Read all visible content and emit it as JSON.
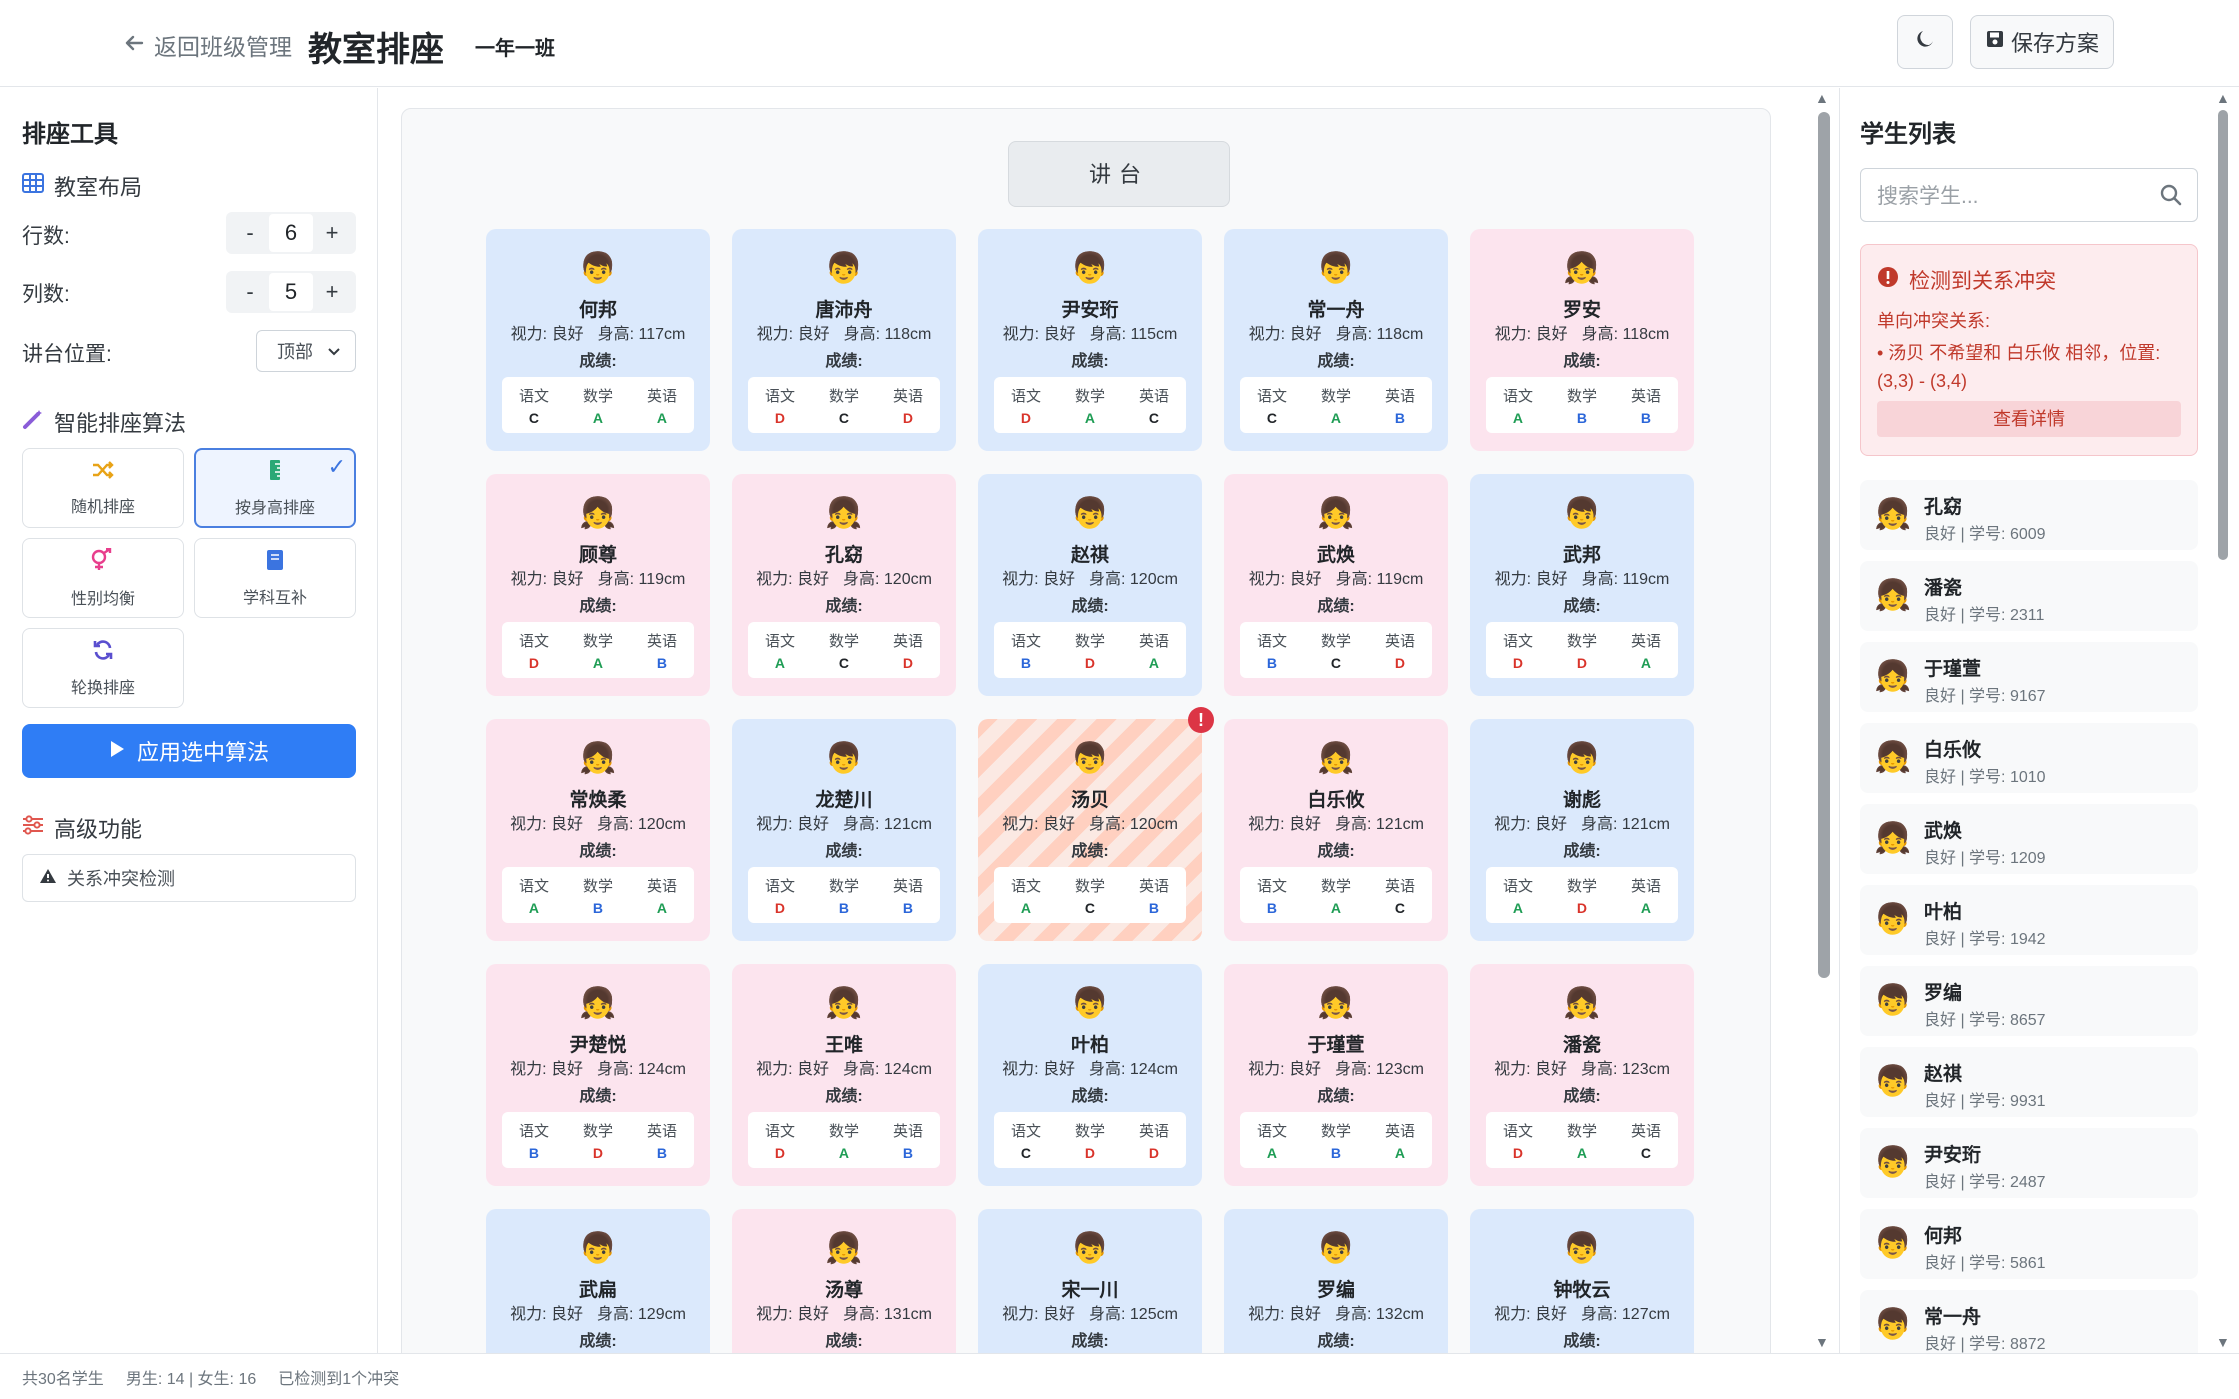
{
  "header": {
    "back_label": "返回班级管理",
    "title": "教室排座",
    "class_name": "一年一班",
    "save_label": "保存方案"
  },
  "tools": {
    "title": "排座工具",
    "layout_heading": "教室布局",
    "rows_label": "行数:",
    "rows_value": "6",
    "cols_label": "列数:",
    "cols_value": "5",
    "podium_label": "讲台位置:",
    "podium_value": "顶部",
    "minus": "-",
    "plus": "+",
    "algo_heading": "智能排座算法",
    "algorithms": [
      "随机排座",
      "按身高排座",
      "性别均衡",
      "学科互补",
      "轮换排座"
    ],
    "selected_algorithm": "按身高排座",
    "apply_label": "应用选中算法",
    "advanced_heading": "高级功能",
    "conflict_check_label": "关系冲突检测"
  },
  "classroom": {
    "podium": "讲台",
    "vision_prefix": "视力: ",
    "height_prefix": "身高: ",
    "grade_label": "成绩:",
    "subjects": [
      "语文",
      "数学",
      "英语"
    ],
    "seats": [
      {
        "name": "何邦",
        "gender": "m",
        "vision": "良好",
        "height": "117cm",
        "grades": [
          "C",
          "A",
          "A"
        ]
      },
      {
        "name": "唐沛舟",
        "gender": "m",
        "vision": "良好",
        "height": "118cm",
        "grades": [
          "D",
          "C",
          "D"
        ]
      },
      {
        "name": "尹安珩",
        "gender": "m",
        "vision": "良好",
        "height": "115cm",
        "grades": [
          "D",
          "A",
          "C"
        ]
      },
      {
        "name": "常一舟",
        "gender": "m",
        "vision": "良好",
        "height": "118cm",
        "grades": [
          "C",
          "A",
          "B"
        ]
      },
      {
        "name": "罗安",
        "gender": "f",
        "vision": "良好",
        "height": "118cm",
        "grades": [
          "A",
          "B",
          "B"
        ]
      },
      {
        "name": "顾尊",
        "gender": "f",
        "vision": "良好",
        "height": "119cm",
        "grades": [
          "D",
          "A",
          "B"
        ]
      },
      {
        "name": "孔窈",
        "gender": "f",
        "vision": "良好",
        "height": "120cm",
        "grades": [
          "A",
          "C",
          "D"
        ]
      },
      {
        "name": "赵祺",
        "gender": "m",
        "vision": "良好",
        "height": "120cm",
        "grades": [
          "B",
          "D",
          "A"
        ]
      },
      {
        "name": "武焕",
        "gender": "f",
        "vision": "良好",
        "height": "119cm",
        "grades": [
          "B",
          "C",
          "D"
        ]
      },
      {
        "name": "武邦",
        "gender": "m",
        "vision": "良好",
        "height": "119cm",
        "grades": [
          "D",
          "D",
          "A"
        ]
      },
      {
        "name": "常焕柔",
        "gender": "f",
        "vision": "良好",
        "height": "120cm",
        "grades": [
          "A",
          "B",
          "A"
        ]
      },
      {
        "name": "龙楚川",
        "gender": "m",
        "vision": "良好",
        "height": "121cm",
        "grades": [
          "D",
          "B",
          "B"
        ]
      },
      {
        "name": "汤贝",
        "gender": "m",
        "vision": "良好",
        "height": "120cm",
        "grades": [
          "A",
          "C",
          "B"
        ],
        "conflict": true
      },
      {
        "name": "白乐攸",
        "gender": "f",
        "vision": "良好",
        "height": "121cm",
        "grades": [
          "B",
          "A",
          "C"
        ]
      },
      {
        "name": "谢彪",
        "gender": "m",
        "vision": "良好",
        "height": "121cm",
        "grades": [
          "A",
          "D",
          "A"
        ]
      },
      {
        "name": "尹楚悦",
        "gender": "f",
        "vision": "良好",
        "height": "124cm",
        "grades": [
          "B",
          "D",
          "B"
        ]
      },
      {
        "name": "王唯",
        "gender": "f",
        "vision": "良好",
        "height": "124cm",
        "grades": [
          "D",
          "A",
          "B"
        ]
      },
      {
        "name": "叶柏",
        "gender": "m",
        "vision": "良好",
        "height": "124cm",
        "grades": [
          "C",
          "D",
          "D"
        ]
      },
      {
        "name": "于瑾萱",
        "gender": "f",
        "vision": "良好",
        "height": "123cm",
        "grades": [
          "A",
          "B",
          "A"
        ]
      },
      {
        "name": "潘瓷",
        "gender": "f",
        "vision": "良好",
        "height": "123cm",
        "grades": [
          "D",
          "A",
          "C"
        ]
      },
      {
        "name": "武扁",
        "gender": "m",
        "vision": "良好",
        "height": "129cm",
        "grades": [
          "",
          "",
          ""
        ]
      },
      {
        "name": "汤尊",
        "gender": "f",
        "vision": "良好",
        "height": "131cm",
        "grades": [
          "",
          "",
          ""
        ]
      },
      {
        "name": "宋一川",
        "gender": "m",
        "vision": "良好",
        "height": "125cm",
        "grades": [
          "",
          "",
          ""
        ]
      },
      {
        "name": "罗编",
        "gender": "m",
        "vision": "良好",
        "height": "132cm",
        "grades": [
          "",
          "",
          ""
        ]
      },
      {
        "name": "钟牧云",
        "gender": "m",
        "vision": "良好",
        "height": "127cm",
        "grades": [
          "",
          "",
          ""
        ]
      }
    ]
  },
  "students_panel": {
    "title": "学生列表",
    "search_placeholder": "搜索学生...",
    "conflict": {
      "title": "检测到关系冲突",
      "subtitle": "单向冲突关系:",
      "item": "• 汤贝 不希望和 白乐攸 相邻，位置: (3,3) - (3,4)",
      "details_label": "查看详情"
    },
    "list": [
      {
        "name": "孔窈",
        "meta": "良好 | 学号: 6009",
        "gender": "f"
      },
      {
        "name": "潘瓷",
        "meta": "良好 | 学号: 2311",
        "gender": "f"
      },
      {
        "name": "于瑾萱",
        "meta": "良好 | 学号: 9167",
        "gender": "f"
      },
      {
        "name": "白乐攸",
        "meta": "良好 | 学号: 1010",
        "gender": "f"
      },
      {
        "name": "武焕",
        "meta": "良好 | 学号: 1209",
        "gender": "f"
      },
      {
        "name": "叶柏",
        "meta": "良好 | 学号: 1942",
        "gender": "m"
      },
      {
        "name": "罗编",
        "meta": "良好 | 学号: 8657",
        "gender": "m"
      },
      {
        "name": "赵祺",
        "meta": "良好 | 学号: 9931",
        "gender": "m"
      },
      {
        "name": "尹安珩",
        "meta": "良好 | 学号: 2487",
        "gender": "m"
      },
      {
        "name": "何邦",
        "meta": "良好 | 学号: 5861",
        "gender": "m"
      },
      {
        "name": "常一舟",
        "meta": "良好 | 学号: 8872",
        "gender": "m"
      }
    ]
  },
  "status": {
    "total": "共30名学生",
    "gender_counts": "男生: 14 | 女生: 16",
    "conflicts": "已检测到1个冲突"
  },
  "icons": {
    "male_avatar": "👦",
    "female_avatar": "👧"
  },
  "colors": {
    "accent": "#2f7df5",
    "male_seat": "#dbe9fc",
    "female_seat": "#fce4ee",
    "conflict": "#dc3545"
  }
}
